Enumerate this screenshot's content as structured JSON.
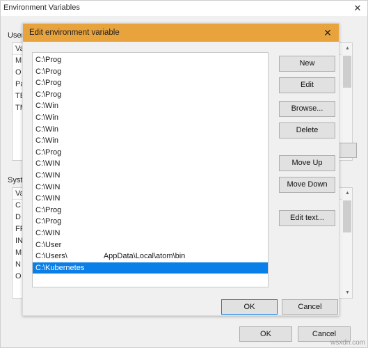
{
  "back_window": {
    "title": "Environment Variables",
    "close_icon": "close-icon",
    "user_section_label": "User",
    "system_section_label": "Syste",
    "user_table": {
      "header": "Va",
      "rows": [
        "M",
        "O",
        "Pa",
        "TE",
        "TM"
      ]
    },
    "system_table": {
      "header": "Va",
      "rows": [
        "C",
        "D",
        "FP",
        "IN",
        "M",
        "N",
        "O"
      ]
    },
    "ok_label": "OK",
    "cancel_label": "Cancel"
  },
  "dialog": {
    "title": "Edit environment variable",
    "close_icon": "close-icon",
    "buttons": {
      "new": "New",
      "edit": "Edit",
      "browse": "Browse...",
      "delete": "Delete",
      "move_up": "Move Up",
      "move_down": "Move Down",
      "edit_text": "Edit text...",
      "ok": "OK",
      "cancel": "Cancel"
    },
    "accent_color": "#e8a33d",
    "selection_color": "#0a7fe8",
    "path_entries": [
      {
        "text": "C:\\Prog",
        "tail": "",
        "selected": false
      },
      {
        "text": "C:\\Prog",
        "tail": "",
        "selected": false
      },
      {
        "text": "C:\\Prog",
        "tail": "",
        "selected": false
      },
      {
        "text": "C:\\Prog",
        "tail": "",
        "selected": false
      },
      {
        "text": "C:\\Win",
        "tail": "",
        "selected": false
      },
      {
        "text": "C:\\Win",
        "tail": "",
        "selected": false
      },
      {
        "text": "C:\\Win",
        "tail": "",
        "selected": false
      },
      {
        "text": "C:\\Win",
        "tail": "",
        "selected": false
      },
      {
        "text": "C:\\Prog",
        "tail": "",
        "selected": false
      },
      {
        "text": "C:\\WIN",
        "tail": "",
        "selected": false
      },
      {
        "text": "C:\\WIN",
        "tail": "",
        "selected": false
      },
      {
        "text": "C:\\WIN",
        "tail": "",
        "selected": false
      },
      {
        "text": "C:\\WIN",
        "tail": "",
        "selected": false
      },
      {
        "text": "C:\\Prog",
        "tail": "",
        "selected": false
      },
      {
        "text": "C:\\Prog",
        "tail": "",
        "selected": false
      },
      {
        "text": "C:\\WIN",
        "tail": "",
        "selected": false
      },
      {
        "text": "C:\\User",
        "tail": "",
        "selected": false
      },
      {
        "text": "C:\\Users\\",
        "tail": "AppData\\Local\\atom\\bin",
        "selected": false
      },
      {
        "text": "C:\\Kubernetes",
        "tail": "",
        "selected": true
      }
    ]
  },
  "watermark": "wsxdn.com"
}
